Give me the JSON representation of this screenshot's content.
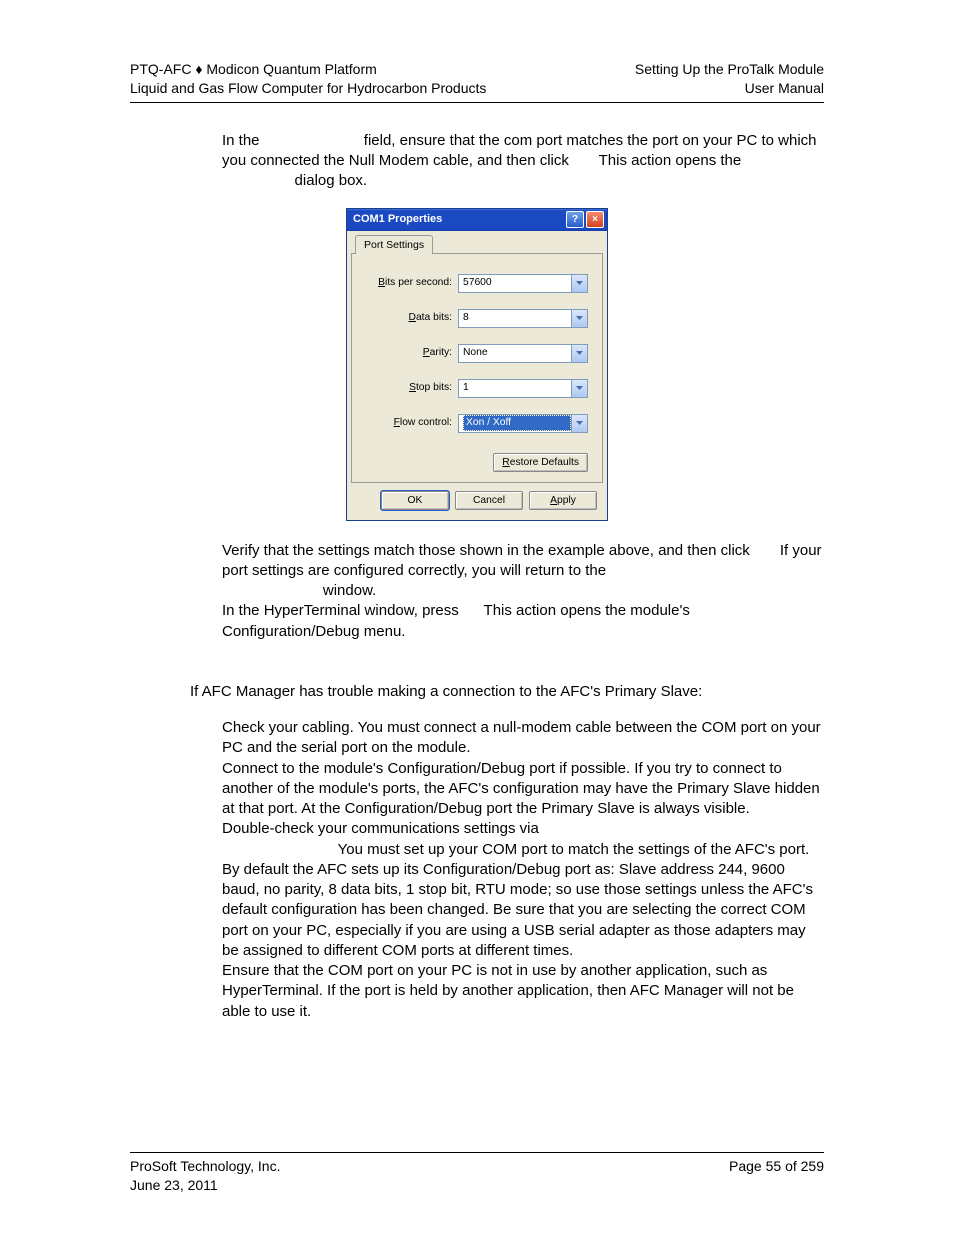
{
  "header": {
    "left1": "PTQ-AFC ♦ Modicon Quantum Platform",
    "left2": "Liquid and Gas Flow Computer for Hydrocarbon Products",
    "right1": "Setting Up the ProTalk Module",
    "right2": "User Manual"
  },
  "body": {
    "p1a": "In the ",
    "p1b": " field, ensure that the com port matches the port on your PC to which you connected the Null Modem cable, and then click ",
    "p1c": " This action opens the ",
    "p1d": " dialog box.",
    "p2a": "Verify that the settings match those shown in the example above, and then click ",
    "p2b": " If your port settings are configured correctly, you will return to the",
    "p2c": " window.",
    "p3a": "In the HyperTerminal window, press ",
    "p3b": " This action opens the module's Configuration/Debug menu.",
    "trouble_intro": "If AFC Manager has trouble making a connection to the AFC's Primary Slave:",
    "t1": "Check your cabling. You must connect a null-modem cable between the COM port on your PC and the serial port on the module.",
    "t2": "Connect to the module's Configuration/Debug port if possible. If you try to connect to another of the module's ports, the AFC's configuration may have the Primary Slave hidden at that port. At the Configuration/Debug port the Primary Slave is always visible.",
    "t3a": "Double-check your communications settings via ",
    "t3b": " You must set up your COM port to match the settings of the AFC's port. By default the AFC sets up its Configuration/Debug port as: Slave address 244, 9600 baud, no parity, 8 data bits, 1 stop bit, RTU mode; so use those settings unless the AFC's default configuration has been changed. Be sure that you are selecting the correct COM port on your PC, especially if you are using a USB serial adapter as those adapters may be assigned to different COM ports at different times.",
    "t4": "Ensure that the COM port on your PC is not in use by another application, such as HyperTerminal. If the port is held by another application, then AFC Manager will not be able to use it."
  },
  "dialog": {
    "title": "COM1 Properties",
    "tab": "Port Settings",
    "fields": {
      "bps_label_pre": "B",
      "bps_label_post": "its per second:",
      "bps_value": "57600",
      "databits_label_pre": "D",
      "databits_label_post": "ata bits:",
      "databits_value": "8",
      "parity_label_pre": "P",
      "parity_label_post": "arity:",
      "parity_value": "None",
      "stopbits_label_pre": "S",
      "stopbits_label_post": "top bits:",
      "stopbits_value": "1",
      "flow_label_pre": "F",
      "flow_label_post": "low control:",
      "flow_value": "Xon / Xoff"
    },
    "restore_pre": "R",
    "restore_post": "estore Defaults",
    "ok": "OK",
    "cancel": "Cancel",
    "apply_pre": "A",
    "apply_post": "pply"
  },
  "footer": {
    "left1": "ProSoft Technology, Inc.",
    "left2": "June 23, 2011",
    "right1": "Page 55 of 259"
  }
}
